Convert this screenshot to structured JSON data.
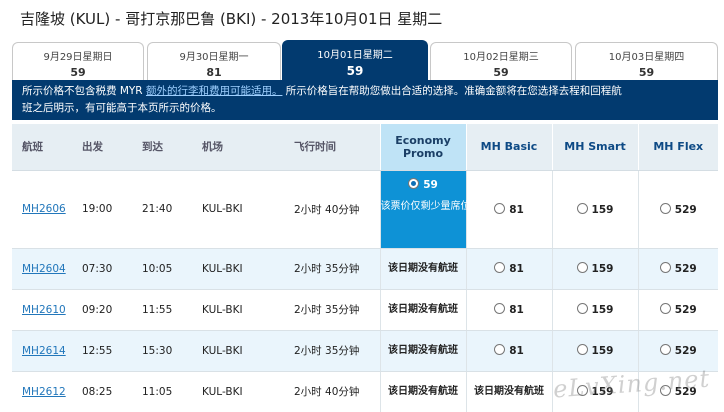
{
  "title": "吉隆坡 (KUL) - 哥打京那巴鲁 (BKI) - 2013年10月01日 星期二",
  "date_tabs": [
    {
      "date": "9月29日星期日",
      "price": "59"
    },
    {
      "date": "9月30日星期一",
      "price": "81"
    },
    {
      "date": "10月01日星期二",
      "price": "59",
      "active": true
    },
    {
      "date": "10月02日星期三",
      "price": "59"
    },
    {
      "date": "10月03日星期四",
      "price": "59"
    }
  ],
  "notice": {
    "line1_a": "所示价格不包含税费 MYR ",
    "link": "额外的行李和费用可能适用。",
    "line1_b": " 所示价格旨在帮助您做出合适的选择。准确金额将在您选择去程和回程航",
    "line2": "班之后明示，有可能高于本页所示的价格。"
  },
  "table": {
    "headers": {
      "flight": "航班",
      "depart": "出发",
      "arrive": "到达",
      "airport": "机场",
      "duration": "飞行时间",
      "economy_promo": "Economy Promo",
      "mh_basic": "MH Basic",
      "mh_smart": "MH Smart",
      "mh_flex": "MH Flex"
    },
    "rows": [
      {
        "flight": "MH2606",
        "depart": "19:00",
        "arrive": "21:40",
        "airport": "KUL-BKI",
        "duration": "2小时 40分钟",
        "promo_price": "59",
        "promo_note": "该票价仅剩少量席位",
        "basic": "81",
        "smart": "159",
        "flex": "529"
      },
      {
        "flight": "MH2604",
        "depart": "07:30",
        "arrive": "10:05",
        "airport": "KUL-BKI",
        "duration": "2小时 35分钟",
        "promo_na": "该日期没有航班",
        "basic": "81",
        "smart": "159",
        "flex": "529"
      },
      {
        "flight": "MH2610",
        "depart": "09:20",
        "arrive": "11:55",
        "airport": "KUL-BKI",
        "duration": "2小时 35分钟",
        "promo_na": "该日期没有航班",
        "basic": "81",
        "smart": "159",
        "flex": "529"
      },
      {
        "flight": "MH2614",
        "depart": "12:55",
        "arrive": "15:30",
        "airport": "KUL-BKI",
        "duration": "2小时 35分钟",
        "promo_na": "该日期没有航班",
        "basic": "81",
        "smart": "159",
        "flex": "529"
      },
      {
        "flight": "MH2612",
        "depart": "08:25",
        "arrive": "11:05",
        "airport": "KUL-BKI",
        "duration": "2小时 40分钟",
        "promo_na": "该日期没有航班",
        "basic_na": "该日期没有航班",
        "smart": "159",
        "flex": "529"
      }
    ]
  },
  "watermark": "eLvXing.net",
  "colors": {
    "nav_dark": "#023a6f",
    "promo_selected": "#0e92d6",
    "link": "#2277bb",
    "row_alt": "#eaf5fc"
  }
}
